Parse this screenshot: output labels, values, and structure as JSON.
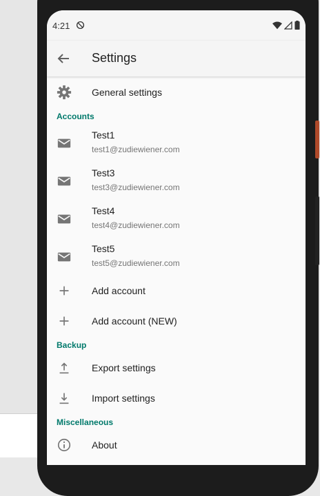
{
  "status_bar": {
    "time": "4:21"
  },
  "app_bar": {
    "title": "Settings"
  },
  "general": {
    "label": "General settings"
  },
  "sections": {
    "accounts": "Accounts",
    "backup": "Backup",
    "misc": "Miscellaneous"
  },
  "accounts": [
    {
      "name": "Test1",
      "email": "test1@zudiewiener.com"
    },
    {
      "name": "Test3",
      "email": "test3@zudiewiener.com"
    },
    {
      "name": "Test4",
      "email": "test4@zudiewiener.com"
    },
    {
      "name": "Test5",
      "email": "test5@zudiewiener.com"
    }
  ],
  "actions": {
    "add_account": "Add account",
    "add_account_new": "Add account (NEW)",
    "export": "Export settings",
    "import": "Import settings",
    "about": "About"
  },
  "colors": {
    "accent": "#00796b",
    "icon": "#757575"
  }
}
